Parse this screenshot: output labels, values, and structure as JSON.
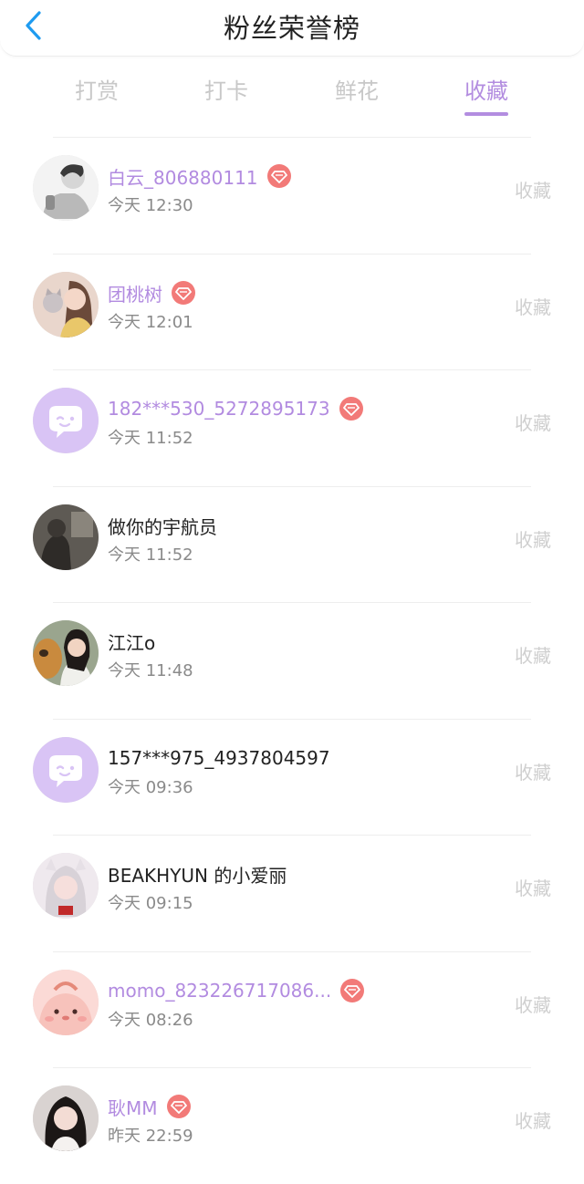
{
  "header": {
    "title": "粉丝荣誉榜"
  },
  "tabs": [
    {
      "label": "打赏"
    },
    {
      "label": "打卡"
    },
    {
      "label": "鲜花"
    },
    {
      "label": "收藏",
      "active": true
    }
  ],
  "colors": {
    "accent": "#b38de0",
    "badge": "#f27a78",
    "chat_avatar": "#d9c4f5"
  },
  "rows": [
    {
      "name": "白云_806880111",
      "vip": true,
      "time": "今天 12:30",
      "action": "收藏",
      "avatar": "sketch-boy"
    },
    {
      "name": "团桃树",
      "vip": true,
      "time": "今天 12:01",
      "action": "收藏",
      "avatar": "girl-with-cat"
    },
    {
      "name": "182***530_5272895173",
      "vip": true,
      "time": "今天 11:52",
      "action": "收藏",
      "avatar": "chat-bubble-default"
    },
    {
      "name": "做你的宇航员",
      "vip": false,
      "time": "今天 11:52",
      "action": "收藏",
      "avatar": "dark-photo"
    },
    {
      "name": "江江o",
      "vip": false,
      "time": "今天 11:48",
      "action": "收藏",
      "avatar": "girl-with-dog"
    },
    {
      "name": "157***975_4937804597",
      "vip": false,
      "time": "今天 09:36",
      "action": "收藏",
      "avatar": "chat-bubble-default"
    },
    {
      "name": "BEAKHYUN 的小爱丽",
      "vip": false,
      "time": "今天 09:15",
      "action": "收藏",
      "avatar": "white-hair-girl"
    },
    {
      "name": "momo_823226717086...",
      "vip": true,
      "time": "今天 08:26",
      "action": "收藏",
      "avatar": "pink-cartoon"
    },
    {
      "name": "耿MM",
      "vip": true,
      "time": "昨天 22:59",
      "action": "收藏",
      "avatar": "girl-portrait"
    }
  ]
}
